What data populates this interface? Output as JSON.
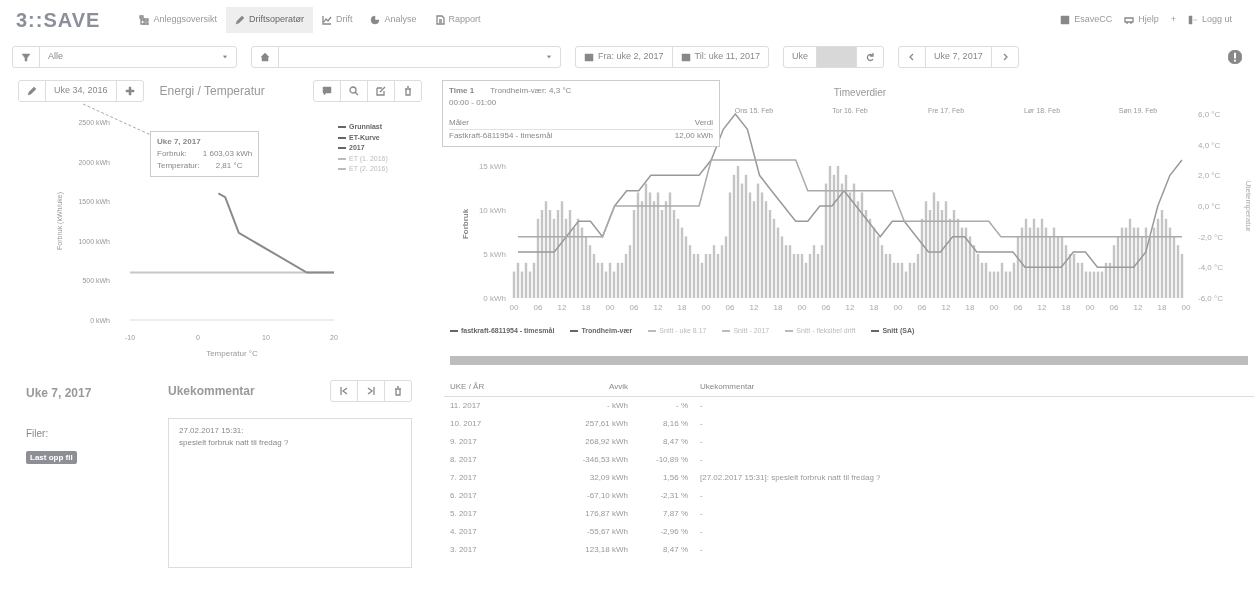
{
  "brand": "3::SAVE",
  "nav_tabs": [
    {
      "label": "Anleggsoversikt",
      "selected": false
    },
    {
      "label": "Driftsoperatør",
      "selected": true
    },
    {
      "label": "Drift",
      "selected": false
    },
    {
      "label": "Analyse",
      "selected": false
    },
    {
      "label": "Rapport",
      "selected": false
    }
  ],
  "user_menu": [
    "EsaveCC",
    "Hjelp",
    "+",
    "Logg ut"
  ],
  "toolbar": {
    "filter": "Alle",
    "from": "Fra: uke 2, 2017",
    "to": "Til: uke 11, 2017",
    "period_label": "Uke",
    "week": "Uke 7, 2017"
  },
  "energy_panel": {
    "week_button": "Uke 34, 2016",
    "title": "Energi / Temperatur",
    "tooltip": {
      "title": "Uke 7, 2017",
      "rows": [
        {
          "label": "Forbruk:",
          "value": "1 603,03 kWh"
        },
        {
          "label": "Temperatur:",
          "value": "2,81 °C"
        }
      ]
    },
    "legend_extra": [
      {
        "label": "2017",
        "emphasis": true
      },
      {
        "label": "ET (1. 2016)",
        "emphasis": false
      },
      {
        "label": "ET (2. 2016)",
        "emphasis": false
      }
    ],
    "chart_data": {
      "type": "line",
      "xlabel": "Temperatur °C",
      "ylabel": "Forbruk (kWh/uke)",
      "xlim": [
        -10,
        20
      ],
      "ylim": [
        0,
        2500
      ],
      "xticks": [
        -10,
        0,
        10,
        20
      ],
      "yticks": [
        {
          "value": 0,
          "label": "0 kWh"
        },
        {
          "value": 500,
          "label": "500 kWh"
        },
        {
          "value": 1000,
          "label": "1000 kWh"
        },
        {
          "value": 1500,
          "label": "1500 kWh"
        },
        {
          "value": 2000,
          "label": "2000 kWh"
        },
        {
          "value": 2500,
          "label": "2500 kWh"
        }
      ],
      "x": [
        -10,
        3,
        4,
        6,
        16,
        20
      ],
      "series": [
        {
          "name": "Grunnlast",
          "color": "#c8c8c8",
          "values": [
            600,
            600,
            600,
            600,
            600,
            600
          ]
        },
        {
          "name": "ET-Kurve",
          "color": "#8a8a8a",
          "values": [
            null,
            1600,
            1550,
            1100,
            600,
            600
          ]
        }
      ]
    }
  },
  "hourly_panel": {
    "title": "Timeverdier",
    "tooltip": {
      "title": "Time 1",
      "series": "Trondheim-vær: 4,3 °C",
      "range": "00:00 - 01:00",
      "col_meter": "Måler",
      "col_value": "Verdi",
      "meter": "Fastkraft-6811954 - timesmål",
      "value": "12,00 kWh"
    },
    "days": [
      "Ons 15. Feb",
      "Tor 16. Feb",
      "Fre 17. Feb",
      "Lør 18. Feb",
      "Søn 19. Feb"
    ],
    "legend_extra": [
      {
        "label": "Snitt - uke 8.17",
        "emphasis": false
      },
      {
        "label": "Snitt - 2017",
        "emphasis": false
      },
      {
        "label": "Snitt - fleksibel drift",
        "emphasis": false
      }
    ],
    "chart_data": {
      "type": "bar",
      "ylabel": "Forbruk",
      "ylim": [
        0,
        15
      ],
      "categories": [
        "00",
        null,
        null,
        null,
        null,
        null,
        "06",
        null,
        null,
        null,
        null,
        null,
        "12",
        null,
        null,
        null,
        null,
        null,
        "18",
        null,
        null,
        null,
        null,
        null,
        "00",
        null,
        null,
        null,
        null,
        null,
        "06",
        null,
        null,
        null,
        null,
        null,
        "12",
        null,
        null,
        null,
        null,
        null,
        "18",
        null,
        null,
        null,
        null,
        null,
        "00",
        null,
        null,
        null,
        null,
        null,
        "06",
        null,
        null,
        null,
        null,
        null,
        "12",
        null,
        null,
        null,
        null,
        null,
        "18",
        null,
        null,
        null,
        null,
        null,
        "00",
        null,
        null,
        null,
        null,
        null,
        "06",
        null,
        null,
        null,
        null,
        null,
        "12",
        null,
        null,
        null,
        null,
        null,
        "18",
        null,
        null,
        null,
        null,
        null,
        "00",
        null,
        null,
        null,
        null,
        null,
        "06",
        null,
        null,
        null,
        null,
        null,
        "12",
        null,
        null,
        null,
        null,
        null,
        "18",
        null,
        null,
        null,
        null,
        null,
        "00",
        null,
        null,
        null,
        null,
        null,
        "06",
        null,
        null,
        null,
        null,
        null,
        "12",
        null,
        null,
        null,
        null,
        null,
        "18",
        null,
        null,
        null,
        null,
        null,
        "00",
        null,
        null,
        null,
        null,
        null,
        "06",
        null,
        null,
        null,
        null,
        null,
        "12",
        null,
        null,
        null,
        null,
        null,
        "18",
        null,
        null,
        null,
        null,
        null,
        "00"
      ],
      "yticks": [
        {
          "value": 0,
          "label": "0 kWh"
        },
        {
          "value": 5,
          "label": "5 kWh"
        },
        {
          "value": 10,
          "label": "10 kWh"
        },
        {
          "value": 15,
          "label": "15 kWh"
        }
      ],
      "series": [
        {
          "name": "fastkraft-6811954 - timesmål",
          "color": "#c4c4c4",
          "values": [
            3,
            4,
            3,
            4,
            3,
            4,
            9,
            10,
            11,
            10,
            9,
            10,
            11,
            9,
            10,
            8,
            9,
            8,
            7,
            6,
            5,
            4,
            4,
            3,
            4,
            3,
            4,
            4,
            5,
            6,
            10,
            12,
            11,
            13,
            12,
            11,
            12,
            10,
            11,
            12,
            10,
            9,
            8,
            7,
            6,
            5,
            5,
            4,
            5,
            5,
            6,
            5,
            6,
            7,
            12,
            14,
            15,
            13,
            14,
            12,
            11,
            13,
            12,
            11,
            10,
            9,
            8,
            7,
            6,
            6,
            5,
            5,
            5,
            4,
            5,
            6,
            5,
            6,
            13,
            15,
            14,
            15,
            13,
            14,
            12,
            13,
            11,
            12,
            10,
            9,
            8,
            7,
            6,
            5,
            5,
            4,
            4,
            4,
            3,
            4,
            4,
            5,
            9,
            11,
            10,
            12,
            11,
            10,
            11,
            9,
            10,
            9,
            8,
            8,
            7,
            6,
            5,
            4,
            4,
            3,
            3,
            3,
            4,
            3,
            3,
            4,
            7,
            8,
            9,
            8,
            9,
            8,
            9,
            8,
            7,
            8,
            7,
            7,
            6,
            5,
            5,
            4,
            4,
            3,
            3,
            3,
            3,
            3,
            4,
            4,
            6,
            7,
            8,
            8,
            9,
            8,
            8,
            7,
            8,
            7,
            8,
            9,
            10,
            9,
            8,
            7,
            6,
            5,
            null
          ]
        }
      ]
    },
    "temperature_overlay": {
      "chart_data": {
        "type": "line",
        "ylabel": "Utetemperatur",
        "ylim": [
          -6,
          6
        ],
        "yticks": [
          {
            "value": -6,
            "label": "-6,0 °C"
          },
          {
            "value": -4,
            "label": "-4,0 °C"
          },
          {
            "value": -2,
            "label": "-2,0 °C"
          },
          {
            "value": 0,
            "label": "0,0 °C"
          },
          {
            "value": 2,
            "label": "2,0 °C"
          },
          {
            "value": 4,
            "label": "4,0 °C"
          },
          {
            "value": 6,
            "label": "6,0 °C"
          }
        ],
        "categories": [
          null,
          null,
          null,
          null,
          null,
          null,
          null,
          null,
          null,
          null,
          null,
          null,
          null,
          null,
          null,
          null,
          null,
          null,
          null,
          null,
          null,
          null,
          null,
          null,
          null,
          null,
          null,
          null,
          null,
          null,
          null,
          null,
          null,
          null,
          null,
          null,
          null,
          null,
          null,
          null,
          null,
          null,
          null,
          null,
          null,
          null,
          null,
          null,
          null,
          null,
          null,
          null,
          null,
          null,
          null,
          null
        ],
        "series": [
          {
            "name": "Trondheim-vær",
            "color": "#999999",
            "values": [
              -3,
              -3,
              -3,
              -3,
              -2,
              -1,
              -1,
              -2,
              0,
              1,
              1,
              2,
              2,
              2,
              2,
              2,
              3,
              5,
              6,
              5,
              2,
              1,
              0,
              -1,
              -1,
              0,
              0,
              1,
              0,
              -1,
              -2,
              -1,
              -1,
              -2,
              -3,
              -3,
              -2,
              -2,
              -3,
              -3,
              -3,
              -3,
              -4,
              -4,
              -4,
              -4,
              -3,
              -3,
              -4,
              -4,
              -4,
              -4,
              -3,
              0,
              2,
              3
            ]
          },
          {
            "name": "Snitt (SA)",
            "color": "#aaaaaa",
            "values": [
              -2,
              -2,
              -2,
              -2,
              -2,
              -2,
              -2,
              -2,
              0,
              0,
              0,
              0,
              0,
              0,
              0,
              0,
              3,
              3,
              3,
              3,
              3,
              3,
              3,
              3,
              1,
              1,
              1,
              1,
              1,
              1,
              1,
              1,
              -1,
              -1,
              -1,
              -1,
              -1,
              -1,
              -1,
              -1,
              -2,
              -2,
              -2,
              -2,
              -2,
              -2,
              -2,
              -2,
              -2,
              -2,
              -2,
              -2,
              -2,
              -2,
              -2,
              -2
            ]
          }
        ]
      }
    }
  },
  "week_panel": {
    "title": "Uke 7, 2017",
    "files_label": "Filer:",
    "file_badge": "Last opp fil"
  },
  "comment_panel": {
    "title": "Ukekommentar",
    "comment_time": "27.02.2017 15:31:",
    "comment_text": "spesielt forbruk natt til fredag ?"
  },
  "table": {
    "columns": [
      "UKE / ÅR",
      "Avvik",
      null,
      "Ukekommentar"
    ],
    "rows": [
      [
        "11. 2017",
        "- kWh",
        "- %",
        "-"
      ],
      [
        "10. 2017",
        "257,61 kWh",
        "8,16 %",
        "-"
      ],
      [
        "9. 2017",
        "268,92 kWh",
        "8,47 %",
        "-"
      ],
      [
        "8. 2017",
        "-346,53 kWh",
        "-10,89 %",
        "-"
      ],
      [
        "7. 2017",
        "32,09 kWh",
        "1,56 %",
        "[27.02.2017 15:31]: spesielt forbruk natt til fredag ?"
      ],
      [
        "6. 2017",
        "-67,10 kWh",
        "-2,31 %",
        "-"
      ],
      [
        "5. 2017",
        "176,87 kWh",
        "7,87 %",
        "-"
      ],
      [
        "4. 2017",
        "-55,67 kWh",
        "-2,96 %",
        "-"
      ],
      [
        "3. 2017",
        "123,18 kWh",
        "8,47 %",
        "-"
      ]
    ]
  }
}
